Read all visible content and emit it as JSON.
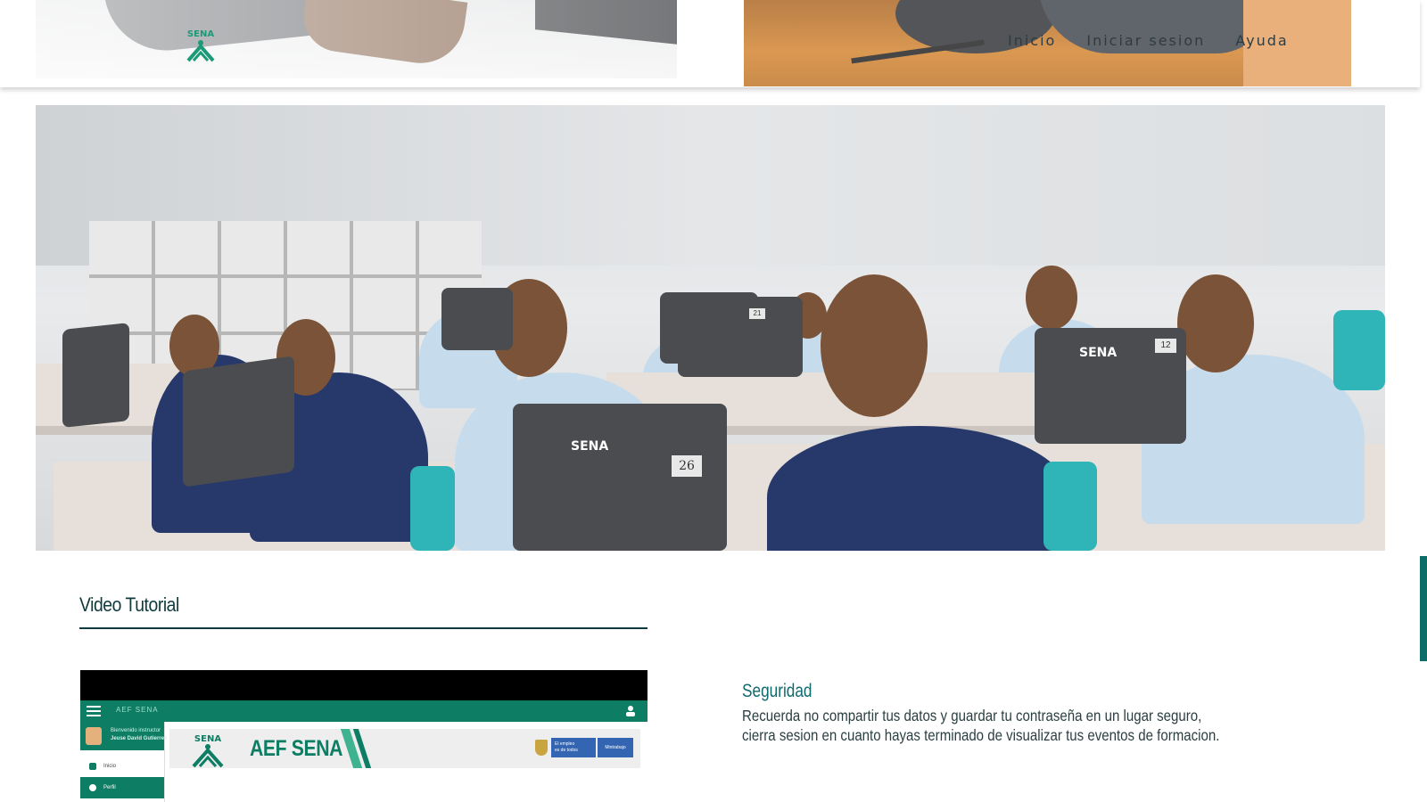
{
  "header": {
    "logo_text": "SENA",
    "nav": [
      {
        "label": "Inicio"
      },
      {
        "label": "Iniciar sesion"
      },
      {
        "label": "Ayuda"
      }
    ]
  },
  "hero": {
    "laptop_numbers": [
      "26",
      "21",
      "12"
    ],
    "logo_marks": [
      "SENA",
      "SENA"
    ]
  },
  "video_section": {
    "title": "Video Tutorial",
    "video": {
      "app_title": "AEF SENA",
      "welcome_line1": "Bienvenido instructor",
      "welcome_line2": "Jeuse David Gutierrez",
      "menu_items": [
        "Inicio",
        "Perfil"
      ],
      "banner_title": "AEF SENA",
      "gov_badge": "El empleo\nes de todos",
      "ministry_badge": "Mintrabajo"
    }
  },
  "security": {
    "title": "Seguridad",
    "text": "Recuerda no compartir tus datos y guardar tu contraseña en un lugar seguro, cierra sesion en cuanto hayas terminado de visualizar tus eventos de formacion."
  },
  "colors": {
    "brand_green": "#0d7d64",
    "title_dark": "#0f3b3e",
    "accent_teal": "#0f6a6e"
  }
}
